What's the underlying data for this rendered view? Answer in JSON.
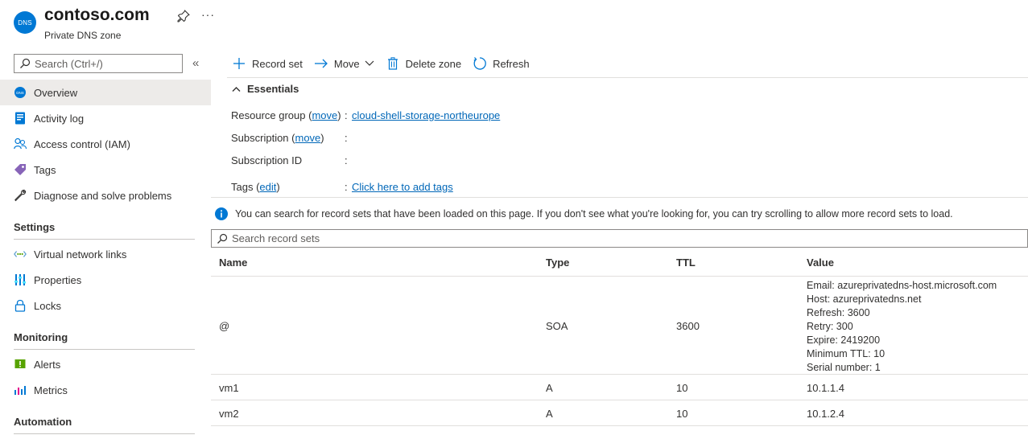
{
  "header": {
    "icon_text": "DNS",
    "title": "contoso.com",
    "subtitle": "Private DNS zone",
    "more": "···"
  },
  "sidebar": {
    "search_placeholder": "Search (Ctrl+/)",
    "collapse": "«",
    "items": [
      {
        "label": "Overview",
        "icon": "dns-icon"
      },
      {
        "label": "Activity log",
        "icon": "activity-log-icon"
      },
      {
        "label": "Access control (IAM)",
        "icon": "people-icon"
      },
      {
        "label": "Tags",
        "icon": "tag-icon"
      },
      {
        "label": "Diagnose and solve problems",
        "icon": "wrench-icon"
      }
    ],
    "settings_header": "Settings",
    "settings_items": [
      {
        "label": "Virtual network links",
        "icon": "link-icon"
      },
      {
        "label": "Properties",
        "icon": "properties-icon"
      },
      {
        "label": "Locks",
        "icon": "lock-icon"
      }
    ],
    "monitoring_header": "Monitoring",
    "monitoring_items": [
      {
        "label": "Alerts",
        "icon": "alert-icon"
      },
      {
        "label": "Metrics",
        "icon": "metrics-icon"
      }
    ],
    "automation_header": "Automation"
  },
  "toolbar": {
    "record_set": "Record set",
    "move": "Move",
    "delete_zone": "Delete zone",
    "refresh": "Refresh"
  },
  "essentials": {
    "label": "Essentials",
    "resource_group_label": "Resource group (",
    "move_link": "move",
    "close_paren": ")",
    "resource_group_value": "cloud-shell-storage-northeurope",
    "subscription_label": "Subscription (",
    "subscription_id_label": "Subscription ID",
    "tags_label": "Tags (",
    "edit_link": "edit",
    "tags_value": "Click here to add tags",
    "colon": ":"
  },
  "info_text": "You can search for record sets that have been loaded on this page. If you don't see what you're looking for, you can try scrolling to allow more record sets to load.",
  "record_search_placeholder": "Search record sets",
  "table": {
    "headers": [
      "Name",
      "Type",
      "TTL",
      "Value"
    ],
    "rows": [
      {
        "name": "@",
        "type": "SOA",
        "ttl": "3600",
        "value": [
          "Email: azureprivatedns-host.microsoft.com",
          "Host: azureprivatedns.net",
          "Refresh: 3600",
          "Retry: 300",
          "Expire: 2419200",
          "Minimum TTL: 10",
          "Serial number: 1"
        ]
      },
      {
        "name": "vm1",
        "type": "A",
        "ttl": "10",
        "value": [
          "10.1.1.4"
        ]
      },
      {
        "name": "vm2",
        "type": "A",
        "ttl": "10",
        "value": [
          "10.1.2.4"
        ]
      }
    ]
  },
  "colors": {
    "accent": "#0078d4",
    "link": "#0067b8",
    "selected": "#edebe9",
    "border": "#e1dfdd"
  }
}
